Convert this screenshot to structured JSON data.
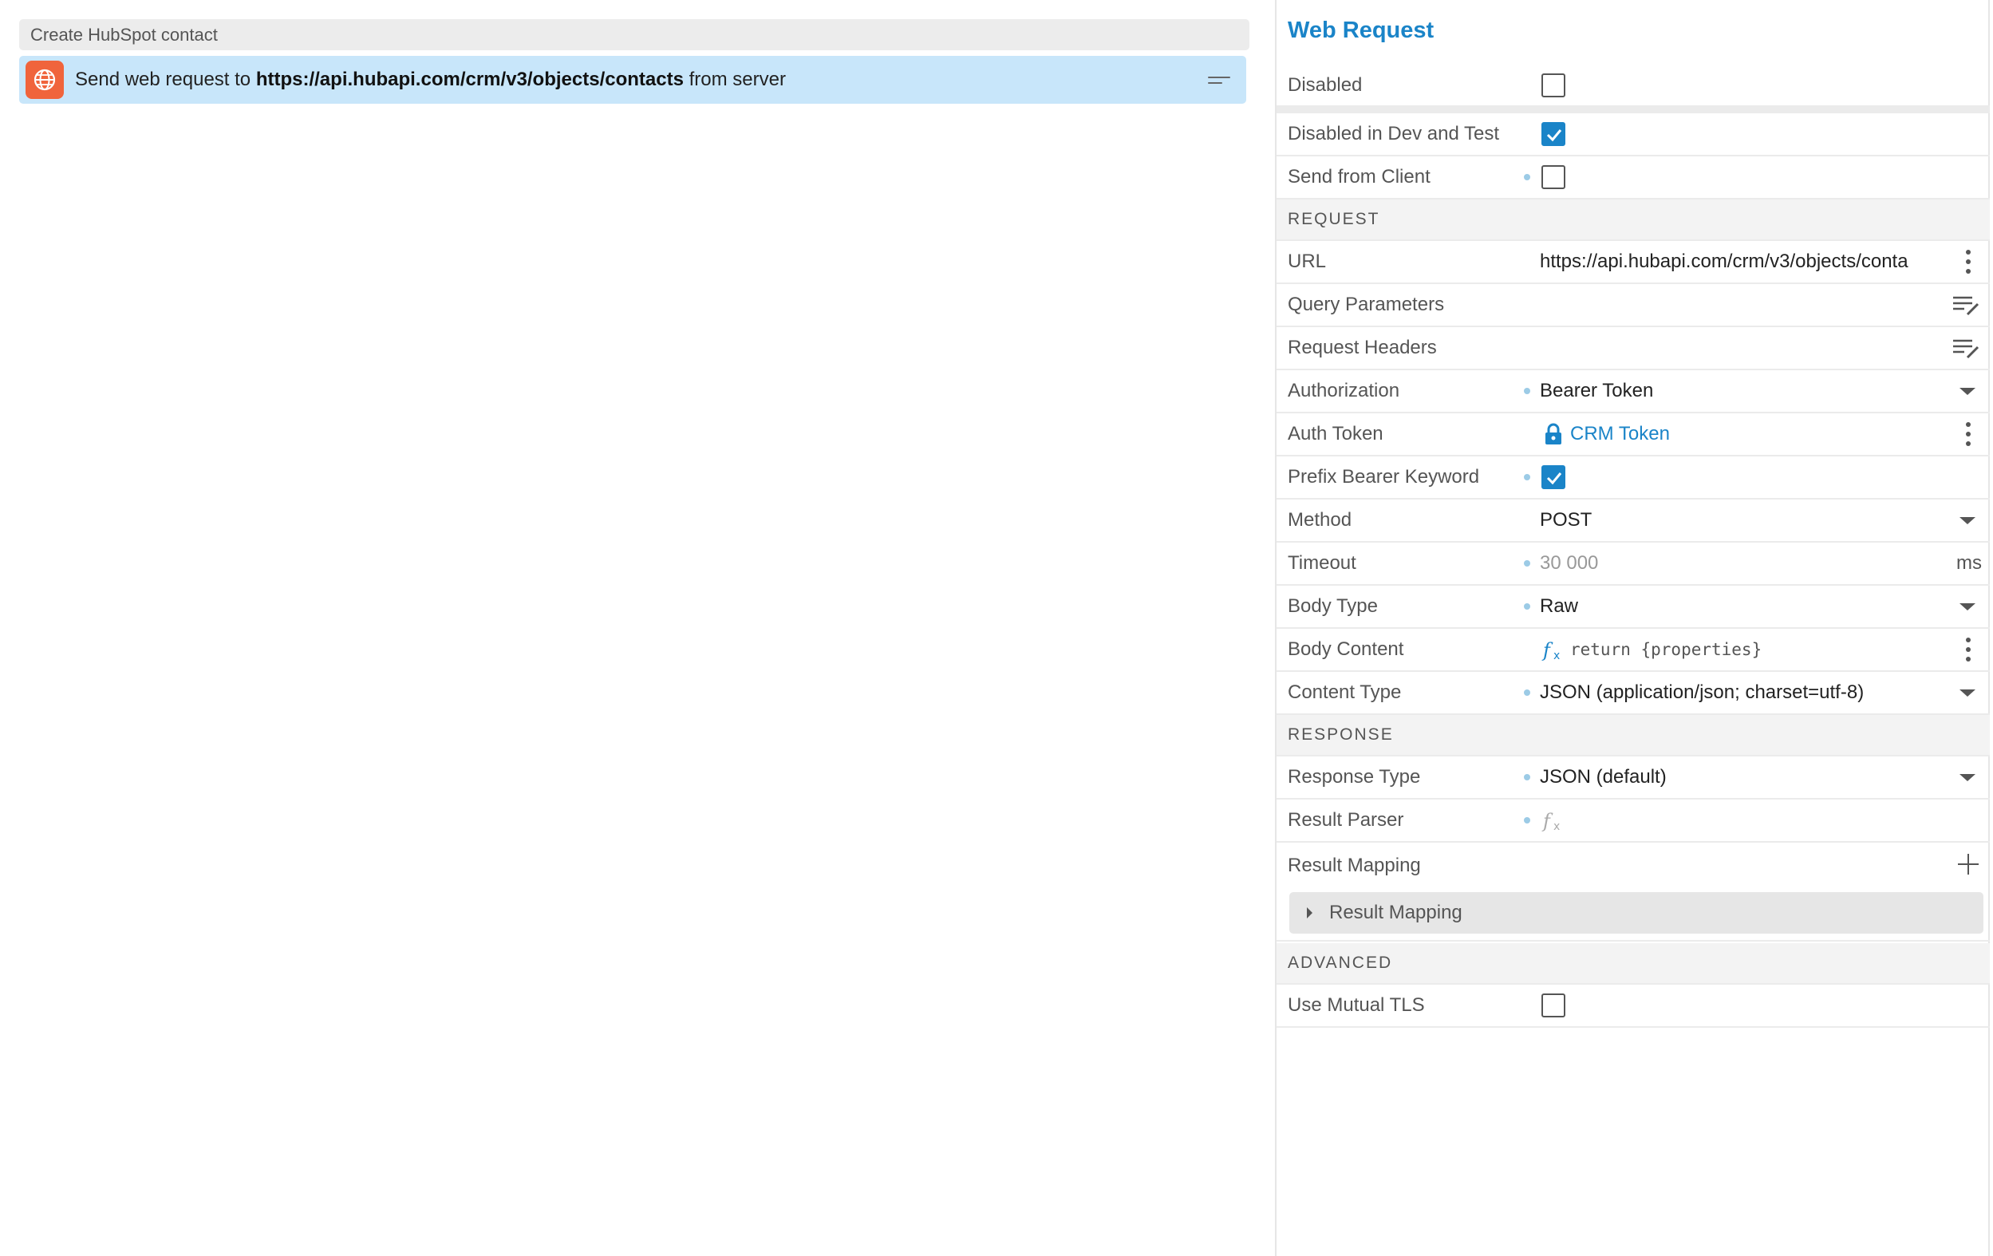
{
  "workflow": {
    "group_title": "Create HubSpot contact",
    "step": {
      "prefix": "Send web request to ",
      "url": "https://api.hubapi.com/crm/v3/objects/contacts",
      "suffix": " from server",
      "icon": "globe-icon",
      "icon_color": "#f0643c",
      "highlight_color": "#c8e6fa"
    }
  },
  "panel": {
    "title": "Web Request",
    "accent": "#1a84c8",
    "rows": {
      "disabled": {
        "label": "Disabled",
        "checked": false
      },
      "disabled_dev_test": {
        "label": "Disabled in Dev and Test",
        "checked": true
      },
      "send_from_client": {
        "label": "Send from Client",
        "checked": false
      },
      "url": {
        "label": "URL",
        "value": "https://api.hubapi.com/crm/v3/objects/conta"
      },
      "query_parameters": {
        "label": "Query Parameters"
      },
      "request_headers": {
        "label": "Request Headers"
      },
      "authorization": {
        "label": "Authorization",
        "value": "Bearer Token"
      },
      "auth_token": {
        "label": "Auth Token",
        "value": "CRM Token"
      },
      "prefix_bearer": {
        "label": "Prefix Bearer Keyword",
        "checked": true
      },
      "method": {
        "label": "Method",
        "value": "POST"
      },
      "timeout": {
        "label": "Timeout",
        "placeholder": "30 000",
        "unit": "ms"
      },
      "body_type": {
        "label": "Body Type",
        "value": "Raw"
      },
      "body_content": {
        "label": "Body Content",
        "value": "return {properties}"
      },
      "content_type": {
        "label": "Content Type",
        "value": "JSON (application/json; charset=utf-8)"
      },
      "response_type": {
        "label": "Response Type",
        "value": "JSON (default)"
      },
      "result_parser": {
        "label": "Result Parser"
      },
      "result_mapping": {
        "label": "Result Mapping",
        "group_label": "Result Mapping"
      },
      "use_mutual_tls": {
        "label": "Use Mutual TLS",
        "checked": false
      }
    },
    "sections": {
      "request": "REQUEST",
      "response": "RESPONSE",
      "advanced": "ADVANCED"
    }
  }
}
